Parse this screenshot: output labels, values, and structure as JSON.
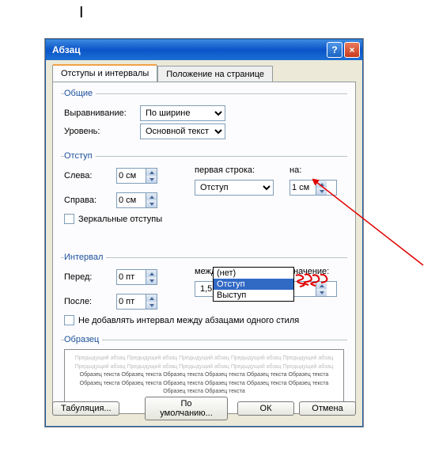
{
  "cursor": "I",
  "dialog": {
    "title": "Абзац",
    "help": "?",
    "close": "×"
  },
  "tabs": {
    "t1": "Отступы и интервалы",
    "t2": "Положение на странице"
  },
  "general": {
    "legend": "Общие",
    "alignment_label": "Выравнивание:",
    "alignment_value": "По ширине",
    "outline_label": "Уровень:",
    "outline_value": "Основной текст"
  },
  "indent": {
    "legend": "Отступ",
    "left_label": "Слева:",
    "left_value": "0 см",
    "right_label": "Справа:",
    "right_value": "0 см",
    "mirror_label": "Зеркальные отступы",
    "special_label": "первая строка:",
    "special_value": "Отступ",
    "by_label": "на:",
    "by_value": "1 см",
    "options": {
      "o1": "(нет)",
      "o2": "Отступ",
      "o3": "Выступ"
    }
  },
  "spacing": {
    "legend": "Интервал",
    "before_label": "Перед:",
    "before_value": "0 пт",
    "after_label": "После:",
    "after_value": "0 пт",
    "line_label": "междустрочный:",
    "line_value": "1,5 строки",
    "at_label": "значение:",
    "at_value": "",
    "noextra_label": "Не добавлять интервал между абзацами одного стиля"
  },
  "sample": {
    "legend": "Образец",
    "prev": "Предыдущий абзац Предыдущий абзац Предыдущий абзац Предыдущий абзац Предыдущий абзац Предыдущий абзац Предыдущий абзац Предыдущий абзац Предыдущий абзац Предыдущий абзац",
    "main": "Образец текста Образец текста Образец текста Образец текста Образец текста Образец текста Образец текста Образец текста Образец текста Образец текста Образец текста Образец текста Образец текста Образец текста"
  },
  "footer": {
    "tabs_btn": "Табуляция...",
    "default_btn": "По умолчанию...",
    "ok_btn": "ОК",
    "cancel_btn": "Отмена"
  }
}
